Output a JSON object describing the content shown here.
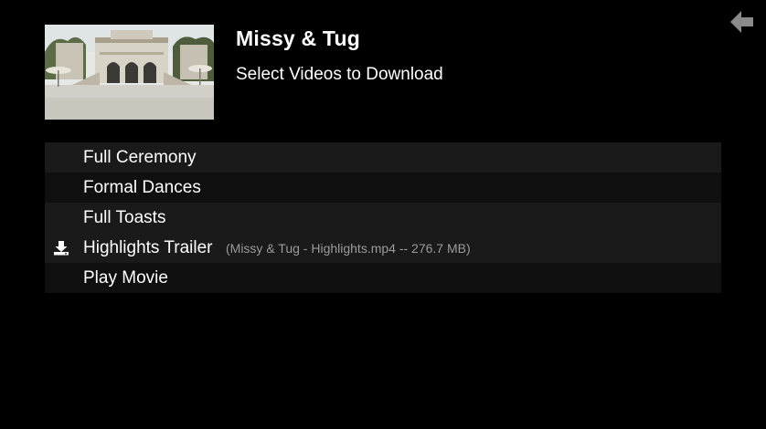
{
  "header": {
    "title": "Missy & Tug",
    "subtitle": "Select Videos to Download"
  },
  "colors": {
    "background": "#000000",
    "row_odd": "#1a1a1a",
    "row_even": "#0f0f0f",
    "text": "#ffffff",
    "muted_text": "#9a9a9a",
    "back_icon": "#8a8a8a"
  },
  "back_button": {
    "icon": "arrow-left-icon"
  },
  "videos": [
    {
      "label": "Full Ceremony"
    },
    {
      "label": "Formal Dances"
    },
    {
      "label": "Full Toasts"
    },
    {
      "label": "Highlights Trailer",
      "file_info": "(Missy & Tug - Highlights.mp4 -- 276.7 MB)",
      "icon": "download-icon"
    },
    {
      "label": "Play Movie"
    }
  ]
}
